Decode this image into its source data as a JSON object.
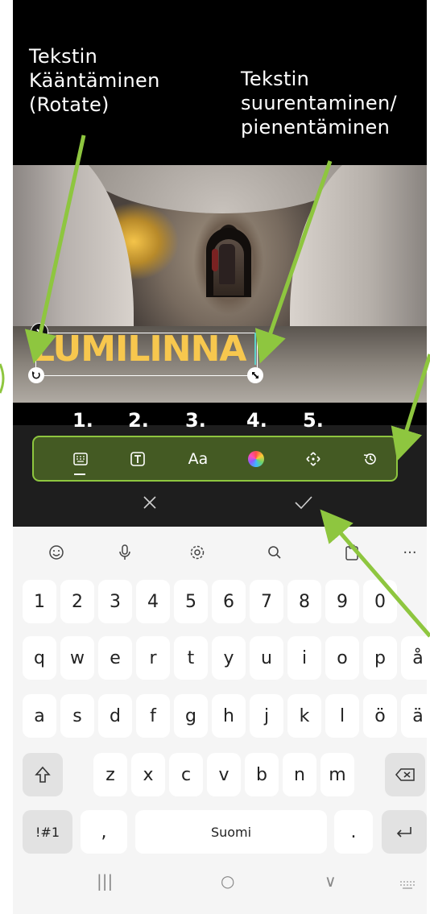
{
  "annotations": {
    "rotate_label": [
      "Tekstin",
      "Kääntäminen",
      "(Rotate)"
    ],
    "resize_label": [
      "Tekstin",
      "suurentaminen/",
      "pienentäminen"
    ],
    "step_numbers": [
      "1.",
      "2.",
      "3.",
      "4.",
      "5."
    ],
    "arrow_color": "#8ec63f"
  },
  "editor": {
    "text_sticker": "LUMILINNA",
    "text_color": "#f7c74e"
  },
  "toolbar": {
    "font_button": "Aa",
    "tools": [
      "keyboard-icon",
      "text-style-icon",
      "font-icon",
      "color-wheel-icon",
      "move-icon",
      "history-icon"
    ]
  },
  "confirm": {
    "cancel_icon": "close-icon",
    "accept_icon": "check-icon"
  },
  "keyboard": {
    "toolbar": [
      "emoji-icon",
      "mic-icon",
      "settings-icon",
      "search-icon",
      "clipboard-icon",
      "more-icon"
    ],
    "more_label": "···",
    "number_row": [
      "1",
      "2",
      "3",
      "4",
      "5",
      "6",
      "7",
      "8",
      "9",
      "0"
    ],
    "row1": [
      "q",
      "w",
      "e",
      "r",
      "t",
      "y",
      "u",
      "i",
      "o",
      "p",
      "å"
    ],
    "row2": [
      "a",
      "s",
      "d",
      "f",
      "g",
      "h",
      "j",
      "k",
      "l",
      "ö",
      "ä"
    ],
    "row3": [
      "z",
      "x",
      "c",
      "v",
      "b",
      "n",
      "m"
    ],
    "symbols_key": "!#1",
    "comma_key": ",",
    "space_label": "Suomi",
    "period_key": ".",
    "nav": {
      "recents": "|||",
      "home": "○",
      "back": "∨"
    }
  }
}
